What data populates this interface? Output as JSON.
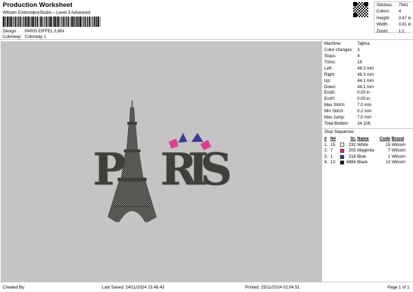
{
  "header": {
    "title": "Production Worksheet",
    "subtitle": "Wilcom EmbroideryStudio – Level 3 Advanced",
    "design_label": "Design:",
    "design_value": "PARIS EIFFEL 3,8IN",
    "colorway_label": "Colorway:",
    "colorway_value": "Colorway 1"
  },
  "stats": [
    {
      "label": "Stitches:",
      "value": "7541"
    },
    {
      "label": "Colors:",
      "value": "4"
    },
    {
      "label": "Height:",
      "value": "3.47 in"
    },
    {
      "label": "Width:",
      "value": "3.81 in"
    },
    {
      "label": "Zoom:",
      "value": "1:1"
    }
  ],
  "info": [
    {
      "label": "Machine:",
      "value": "Tajima"
    },
    {
      "label": "Color changes:",
      "value": "3"
    },
    {
      "label": "Stops:",
      "value": "4"
    },
    {
      "label": "Trims:",
      "value": "18"
    },
    {
      "label": "Left:",
      "value": "48.3 mm"
    },
    {
      "label": "Right:",
      "value": "48.3 mm"
    },
    {
      "label": "Up:",
      "value": "44.1 mm"
    },
    {
      "label": "Down:",
      "value": "44.1 mm"
    },
    {
      "label": "EndX:",
      "value": "0.00 in"
    },
    {
      "label": "EndY:",
      "value": "0.00 in"
    },
    {
      "label": "Max Stitch:",
      "value": "7.0 mm"
    },
    {
      "label": "Min Stitch:",
      "value": "0.2 mm"
    },
    {
      "label": "Max Jump:",
      "value": "7.0 mm"
    },
    {
      "label": "Total Bobbin:",
      "value": "34.10ft"
    }
  ],
  "stop_sequence": {
    "title": "Stop Sequence:",
    "columns": [
      "#",
      "N#",
      "St.",
      "Name",
      "Code",
      "Brand"
    ],
    "rows": [
      {
        "idx": "1.",
        "n": "15",
        "color": "#ffffff",
        "st": "232",
        "name": "White",
        "code": "15",
        "brand": "Wilcom"
      },
      {
        "idx": "2.",
        "n": "7",
        "color": "#e0187a",
        "st": "205",
        "name": "Magenta",
        "code": "7",
        "brand": "Wilcom"
      },
      {
        "idx": "3.",
        "n": "1",
        "color": "#2a2f8a",
        "st": "218",
        "name": "Blue",
        "code": "1",
        "brand": "Wilcom"
      },
      {
        "idx": "4.",
        "n": "13",
        "color": "#0e0e0e",
        "st": "6884",
        "name": "Black",
        "code": "13",
        "brand": "Wilcom"
      }
    ]
  },
  "design": {
    "text": "PARIS",
    "thread_color": "#3f3f3b",
    "flag_blue": "#3b3a8e",
    "flag_pink": "#e23b93",
    "canvas_bg": "#c4c4c4"
  },
  "footer": {
    "created_by": "Created By:",
    "last_saved": "Last Saved: 24/11/2024 23.48.43",
    "printed": "Printed: 25/11/2024 02.04.51",
    "page": "Page 1 of 1"
  }
}
